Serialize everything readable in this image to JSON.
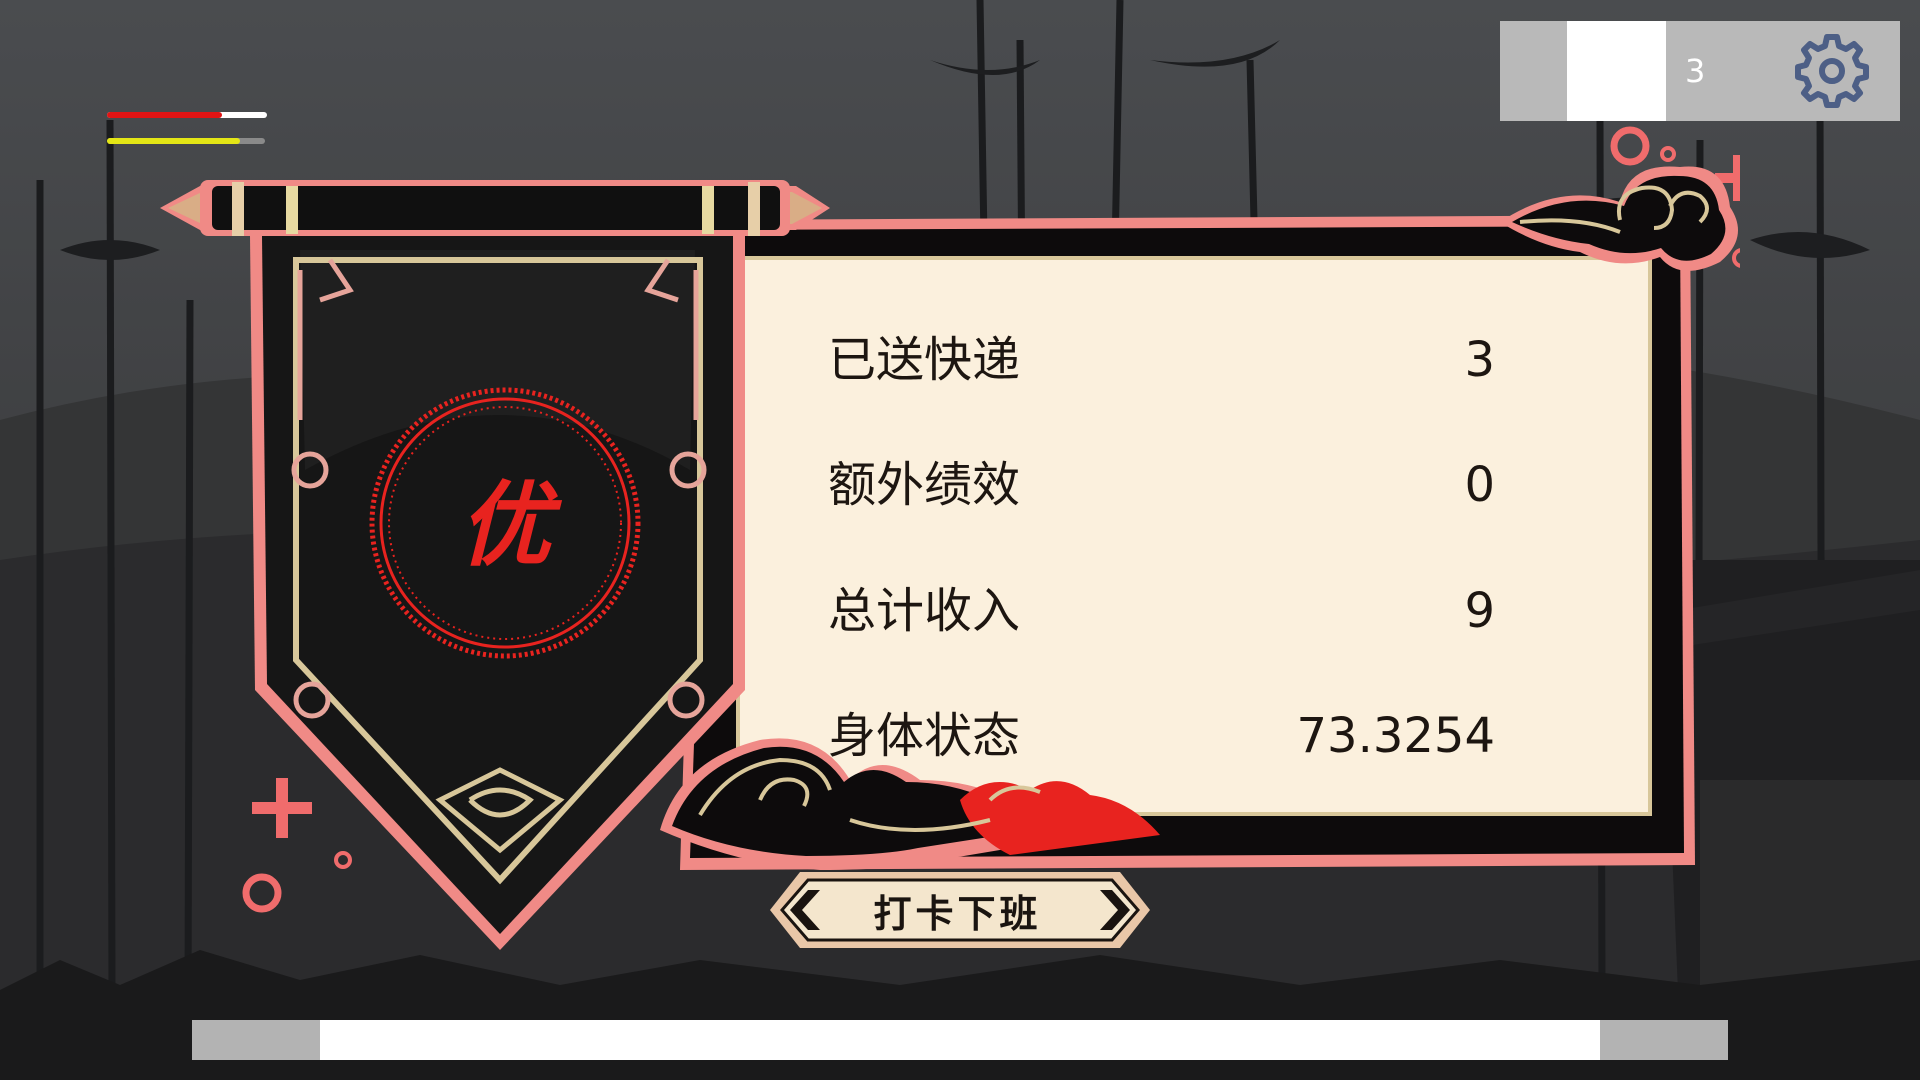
{
  "hud": {
    "count": "3",
    "settings_icon": "gear-icon"
  },
  "status_bars": {
    "health": {
      "fraction": 0.72,
      "color": "#e01414",
      "track_color": "#ffffff"
    },
    "stamina": {
      "fraction": 0.84,
      "color": "#e4e616",
      "track_color": "#8a8a8a"
    }
  },
  "result": {
    "grade": "优",
    "stats": [
      {
        "label": "已送快递",
        "value": "3"
      },
      {
        "label": "额外绩效",
        "value": "0"
      },
      {
        "label": "总计收入",
        "value": "9"
      },
      {
        "label": "身体状态",
        "value": "73.3254"
      }
    ],
    "clock_out_label": "打卡下班"
  },
  "bottom_bar": {
    "fraction": 0.8333
  },
  "colors": {
    "accent_red": "#e8231f",
    "panel_cream": "#fbf0dd",
    "frame_pink": "#f08a86",
    "gold": "#d8c79a"
  }
}
